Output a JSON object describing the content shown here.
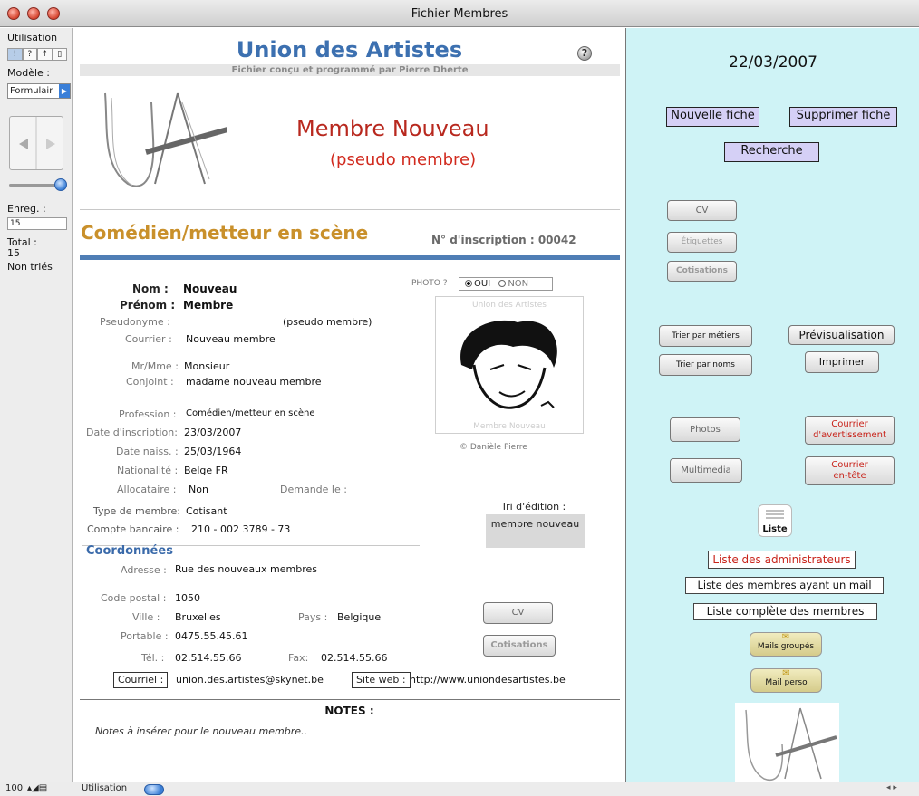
{
  "window": {
    "title": "Fichier Membres"
  },
  "sidebar": {
    "mode_label": "Utilisation",
    "model_label": "Modèle :",
    "model_value": "Formulair",
    "record_label": "Enreg. :",
    "record_value": "15",
    "total_label": "Total :",
    "total_value": "15",
    "sort_status": "Non triés"
  },
  "header": {
    "app_title": "Union des Artistes",
    "subtitle": "Fichier conçu et programmé par Pierre Dherte",
    "help": "?",
    "member_name": "Membre Nouveau",
    "pseudo": "(pseudo membre)"
  },
  "record": {
    "role": "Comédien/metteur en scène",
    "registration_label": "N° d'inscription :",
    "registration_number": "00042",
    "photo": {
      "label": "PHOTO ?",
      "oui": "OUI",
      "non": "NON",
      "selected": "OUI",
      "top_caption": "Union des Artistes",
      "bottom_caption": "Membre Nouveau",
      "copyright": "© Danièle Pierre"
    },
    "fields": {
      "nom": {
        "label": "Nom :",
        "value": "Nouveau"
      },
      "prenom": {
        "label": "Prénom :",
        "value": "Membre"
      },
      "pseudonyme": {
        "label": "Pseudonyme :",
        "value": "(pseudo membre)"
      },
      "courrier": {
        "label": "Courrier :",
        "value": "Nouveau membre"
      },
      "mrmme": {
        "label": "Mr/Mme :",
        "value": "Monsieur"
      },
      "conjoint": {
        "label": "Conjoint :",
        "value": "madame nouveau membre"
      },
      "profession": {
        "label": "Profession :",
        "value": "Comédien/metteur en scène"
      },
      "date_inscription": {
        "label": "Date d'inscription:",
        "value": "23/03/2007"
      },
      "date_naiss": {
        "label": "Date naiss. :",
        "value": "25/03/1964"
      },
      "nationalite": {
        "label": "Nationalité :",
        "value": "Belge FR"
      },
      "allocataire": {
        "label": "Allocataire :",
        "value": "Non"
      },
      "demande": {
        "label": "Demande le :",
        "value": ""
      },
      "type_membre": {
        "label": "Type de membre:",
        "value": "Cotisant"
      },
      "compte": {
        "label": "Compte bancaire :",
        "value": "210 - 002 3789 - 73"
      }
    },
    "tri": {
      "label": "Tri d'édition :",
      "value": "membre nouveau"
    },
    "coordonnees": {
      "title": "Coordonnées",
      "adresse": {
        "label": "Adresse :",
        "value": "Rue des nouveaux membres"
      },
      "code_postal": {
        "label": "Code postal :",
        "value": "1050"
      },
      "ville": {
        "label": "Ville :",
        "value": "Bruxelles"
      },
      "pays": {
        "label": "Pays :",
        "value": "Belgique"
      },
      "portable": {
        "label": "Portable :",
        "value": "0475.55.45.61"
      },
      "tel": {
        "label": "Tél. :",
        "value": "02.514.55.66"
      },
      "fax": {
        "label": "Fax:",
        "value": "02.514.55.66"
      },
      "courriel": {
        "label": "Courriel :",
        "value": "union.des.artistes@skynet.be"
      },
      "site": {
        "label": "Site web :",
        "value": "http://www.uniondesartistes.be"
      }
    },
    "buttons": {
      "cv": "CV",
      "cotisations": "Cotisations"
    },
    "notes": {
      "title": "NOTES :",
      "text": "Notes à insérer pour le nouveau membre.."
    }
  },
  "right_panel": {
    "date": "22/03/2007",
    "nouvelle_fiche": "Nouvelle fiche",
    "supprimer_fiche": "Supprimer fiche",
    "recherche": "Recherche",
    "cv": "CV",
    "etiquettes": "Étiquettes",
    "cotisations": "Cotisations",
    "trier_metiers": "Trier par métiers",
    "previsualisation": "Prévisualisation",
    "trier_noms": "Trier par noms",
    "imprimer": "Imprimer",
    "photos": "Photos",
    "courrier_avert_1": "Courrier",
    "courrier_avert_2": "d'avertissement",
    "multimedia": "Multimedia",
    "courrier_entete_1": "Courrier",
    "courrier_entete_2": "en-tête",
    "liste": "Liste",
    "liste_admin": "Liste des administrateurs",
    "liste_mail": "Liste des membres ayant un mail",
    "liste_complete": "Liste complète des membres",
    "mails_groupes": "Mails groupés",
    "mail_perso": "Mail perso"
  },
  "statusbar": {
    "zoom": "100",
    "mode": "Utilisation"
  }
}
